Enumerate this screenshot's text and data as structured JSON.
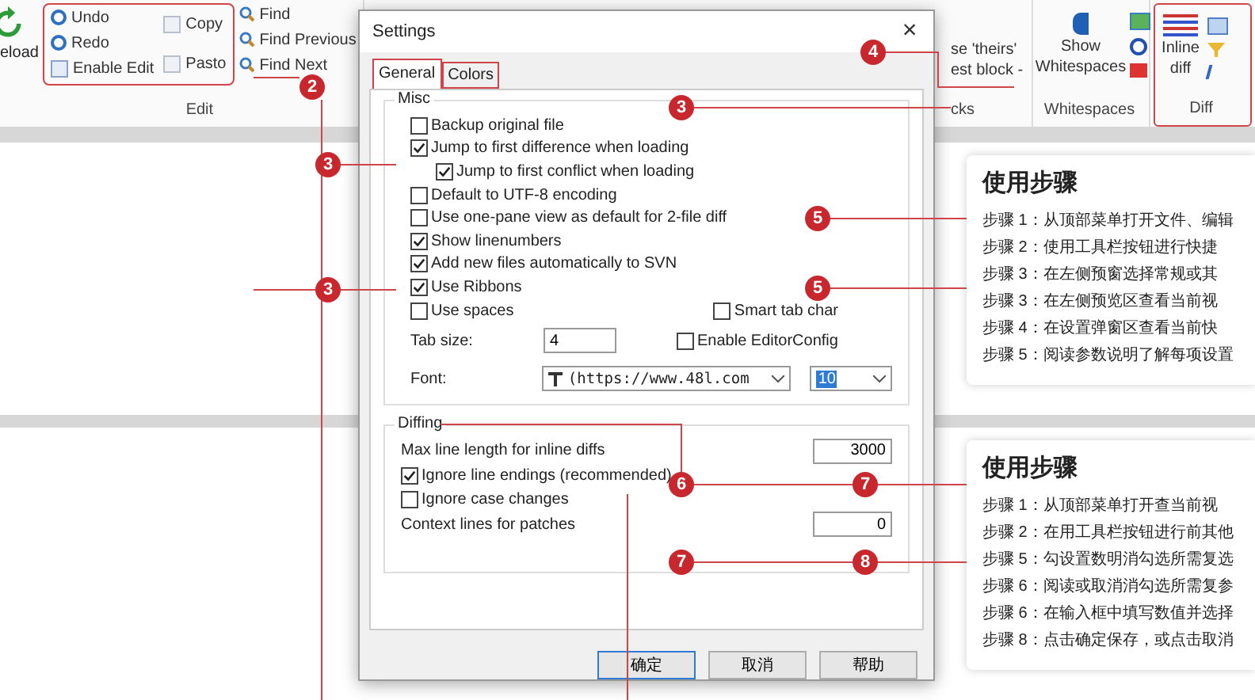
{
  "ribbon": {
    "reload": "eload",
    "edit": {
      "title": "Edit",
      "column_1": [
        "Undo",
        "Redo",
        "Enable Edit"
      ],
      "column_2": [
        "Copy",
        "Pasto"
      ],
      "column_3": [
        "Find",
        "Find Previous",
        "Find Next"
      ]
    },
    "blocks": {
      "title": "cks",
      "button": [
        "se 'theirs'",
        "est block -"
      ]
    },
    "whitespaces": {
      "title": "Whitespaces",
      "button": "Show Whitespaces"
    },
    "diff": {
      "title": "Diff",
      "button": "Inline diff"
    }
  },
  "dialog": {
    "title": "Settings",
    "close": "×",
    "tabs": [
      {
        "label": "General",
        "selected": true
      },
      {
        "label": "Colors",
        "selected": false
      }
    ],
    "misc": {
      "legend": "Misc",
      "options": [
        {
          "label": "Backup original file",
          "checked": false
        },
        {
          "label": "Jump to first difference when loading",
          "checked": true,
          "children": [
            {
              "label": "Jump to first conflict when loading",
              "checked": true
            }
          ]
        },
        {
          "label": "Default to UTF-8 encoding",
          "checked": false
        },
        {
          "label": "Use one-pane view as default for 2-file diff",
          "checked": false
        },
        {
          "label": "Show linenumbers",
          "checked": true
        },
        {
          "label": "Add new files automatically to SVN",
          "checked": true
        },
        {
          "label": "Use Ribbons",
          "checked": true
        }
      ],
      "use_spaces": {
        "label": "Use spaces",
        "checked": false
      },
      "smart_tab": {
        "label": "Smart tab char",
        "checked": false
      },
      "tab_size": {
        "label": "Tab size:",
        "value": "4"
      },
      "editorconfig": {
        "label": "Enable EditorConfig",
        "checked": false
      },
      "font": {
        "label": "Font:",
        "value": "(https://www.48l.com",
        "size": "10"
      }
    },
    "diffing": {
      "legend": "Diffing",
      "max_line": {
        "label": "Max line length for inline diffs",
        "value": "3000"
      },
      "options": [
        {
          "label": "Ignore line endings (recommended)",
          "checked": true
        },
        {
          "label": "Ignore case changes",
          "checked": false
        }
      ],
      "context": {
        "label": "Context lines for patches",
        "value": "0"
      }
    },
    "buttons": [
      "确定",
      "取消",
      "帮助"
    ]
  },
  "cards": [
    {
      "title": "使用步骤",
      "steps": [
        "步骤 1：从顶部菜单打开文件、编辑",
        "步骤 2：使用工具栏按钮进行快捷",
        "步骤 3：在左侧预窗选择常规或其",
        "步骤 3：在左侧预览区查看当前视",
        "步骤 4：在设置弹窗区查看当前快",
        "步骤 5：阅读参数说明了解每项设置"
      ]
    },
    {
      "title": "使用步骤",
      "steps": [
        "步骤 1：从顶部菜单打开查当前视",
        "步骤 2：在用工具栏按钮进行前其他",
        "步骤 5：勾设置数明消勾选所需复选",
        "步骤 6：阅读或取消消勾选所需复参",
        "步骤 6：在输入框中填写数值并选择",
        "步骤 8：点击确定保存，或点击取消"
      ]
    }
  ],
  "callouts": [
    {
      "label": "2"
    },
    {
      "label": "4"
    },
    {
      "label": "3"
    },
    {
      "label": "3"
    },
    {
      "label": "5"
    },
    {
      "label": "5"
    },
    {
      "label": "3"
    },
    {
      "label": "6"
    },
    {
      "label": "7"
    },
    {
      "label": "7"
    },
    {
      "label": "8"
    }
  ]
}
